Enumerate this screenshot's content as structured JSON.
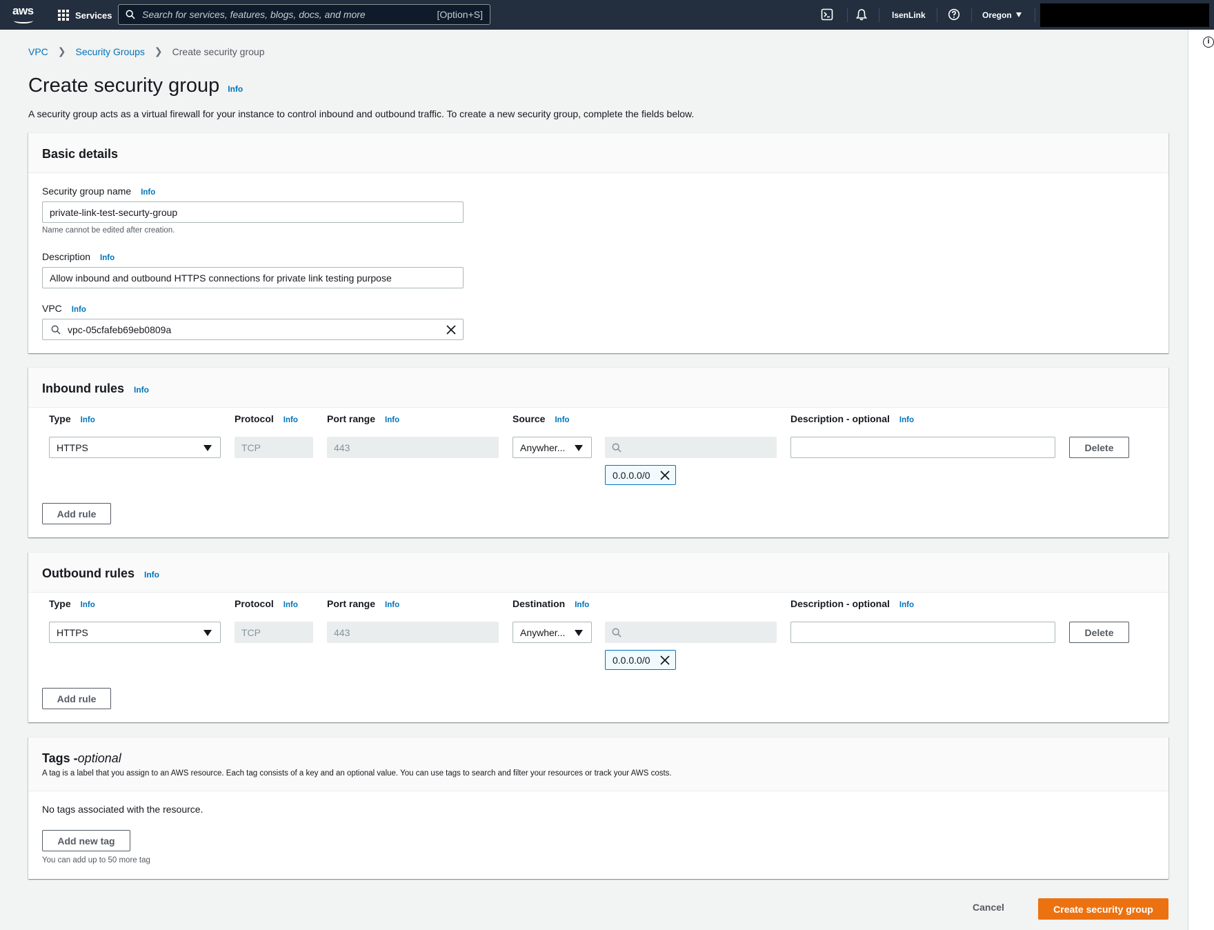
{
  "topnav": {
    "logo": "aws",
    "services_label": "Services",
    "search_placeholder": "Search for services, features, blogs, docs, and more",
    "search_shortcut": "[Option+S]",
    "account_label": "lsenLink",
    "region_label": "Oregon",
    "icons": [
      "cloudshell-icon",
      "bell-icon",
      "help-icon"
    ]
  },
  "breadcrumb": {
    "items": [
      "VPC",
      "Security Groups"
    ],
    "current": "Create security group"
  },
  "page": {
    "title": "Create security group",
    "info": "Info",
    "description": "A security group acts as a virtual firewall for your instance to control inbound and outbound traffic. To create a new security group, complete the fields below."
  },
  "basic_details": {
    "heading": "Basic details",
    "name_label": "Security group name",
    "name_value": "private-link-test-securty-group",
    "name_hint": "Name cannot be edited after creation.",
    "description_label": "Description",
    "description_value": "Allow inbound and outbound HTTPS connections for private link testing purpose",
    "vpc_label": "VPC",
    "vpc_value": "vpc-05cfafeb69eb0809a"
  },
  "inbound": {
    "heading": "Inbound rules",
    "columns": {
      "type": "Type",
      "protocol": "Protocol",
      "port_range": "Port range",
      "source": "Source",
      "description": "Description - optional"
    },
    "rule": {
      "type": "HTTPS",
      "protocol": "TCP",
      "port_range": "443",
      "source": "Anywher...",
      "cidr": "0.0.0.0/0",
      "description": ""
    },
    "delete_label": "Delete",
    "add_rule_label": "Add rule"
  },
  "outbound": {
    "heading": "Outbound rules",
    "columns": {
      "type": "Type",
      "protocol": "Protocol",
      "port_range": "Port range",
      "destination": "Destination",
      "description": "Description - optional"
    },
    "rule": {
      "type": "HTTPS",
      "protocol": "TCP",
      "port_range": "443",
      "destination": "Anywher...",
      "cidr": "0.0.0.0/0",
      "description": ""
    },
    "delete_label": "Delete",
    "add_rule_label": "Add rule"
  },
  "tags": {
    "heading": "Tags - ",
    "heading_optional": "optional",
    "subtitle": "A tag is a label that you assign to an AWS resource. Each tag consists of a key and an optional value. You can use tags to search and filter your resources or track your AWS costs.",
    "empty_text": "No tags associated with the resource.",
    "add_tag_label": "Add new tag",
    "limit_hint": "You can add up to 50 more tag"
  },
  "footer": {
    "cancel_label": "Cancel",
    "create_label": "Create security group"
  },
  "colors": {
    "nav_bg": "#232f3e",
    "link": "#0073bb",
    "primary": "#ec7211",
    "page_bg": "#f2f3f3"
  }
}
